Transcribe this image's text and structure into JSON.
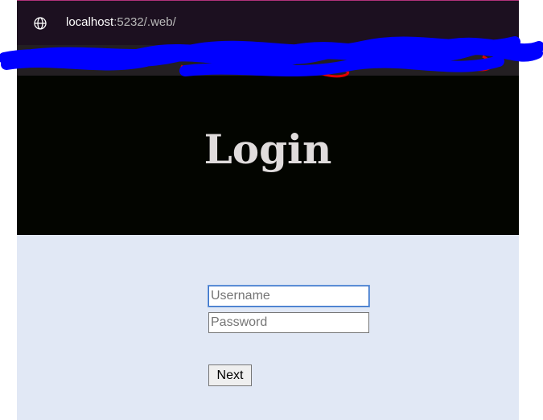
{
  "browser": {
    "url_host": "localhost",
    "url_path": ":5232/.web/",
    "icon": "globe-icon"
  },
  "page": {
    "title": "Login",
    "username_placeholder": "Username",
    "password_placeholder": "Password",
    "next_label": "Next"
  },
  "colors": {
    "header_bg": "#030500",
    "title_color": "#e0dcdc",
    "content_bg": "#e1e8f5",
    "redaction": "#0000ff"
  }
}
